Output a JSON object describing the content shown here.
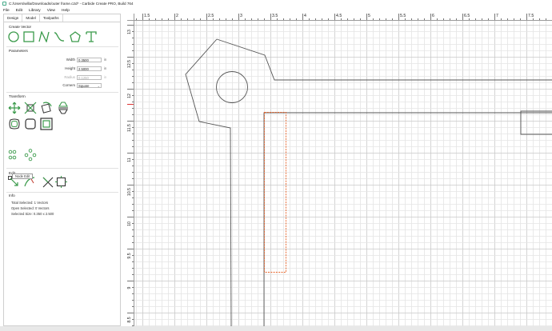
{
  "window": {
    "title": "C:/Users/willa/Downloads/outer frame.c2d* - Carbide Create PRO, Build 764"
  },
  "menu": {
    "items": [
      "File",
      "Edit",
      "Library",
      "View",
      "Help"
    ]
  },
  "panel": {
    "tabs": [
      "Design",
      "Model",
      "Toolpaths"
    ],
    "active_tab": "Design",
    "sections": {
      "create_vector": "Create Vector",
      "parameters": "Parameters",
      "transform": "Transform",
      "edit": "Edit",
      "info": "Info"
    },
    "create_vector_icons": [
      "circle-icon",
      "rectangle-icon",
      "polyline-icon",
      "curve-icon",
      "polygon-icon",
      "text-icon"
    ],
    "parameters": {
      "width_label": "Width",
      "width_value": "0.3500",
      "height_label": "Height",
      "height_value": "2.5000",
      "radius_label": "Radius",
      "radius_value": "0.1250",
      "corners_label": "Corners",
      "corners_value": "Square",
      "unit": "in"
    },
    "transform_icons": [
      "move-icon",
      "scale-icon",
      "rotate-icon",
      "mirror-icon",
      "offset-icon",
      "boolean-icon",
      "align-icon",
      "group-icon",
      "array-icon",
      "circle-array-icon"
    ],
    "edit_icons": [
      "node-edit-icon",
      "trim-icon",
      "join-icon",
      "boundary-icon"
    ],
    "tooltip": "Node Edit",
    "info": {
      "total_selected": "Total Selected:  1 Vectors",
      "open_selected": "Open Selected:  0 Vectors",
      "selected_size": "Selected Size:   0.350 x 2.500"
    }
  },
  "ruler": {
    "top_labels": [
      "1.5",
      "2",
      "2.5",
      "3",
      "3.5",
      "4",
      "4.5",
      "5",
      "5.5",
      "6",
      "6.5",
      "7",
      "7.5"
    ],
    "left_labels": [
      "13",
      "12.5",
      "12",
      "11.5",
      "11",
      "10.5",
      "10",
      "9.5",
      "9",
      "8.5"
    ]
  },
  "colors": {
    "selection": "#e8642a",
    "vector": "#555555",
    "grid_minor": "#e4e4e4",
    "grid_major": "#c9c9c9",
    "icon_green": "#3a9a4a"
  }
}
